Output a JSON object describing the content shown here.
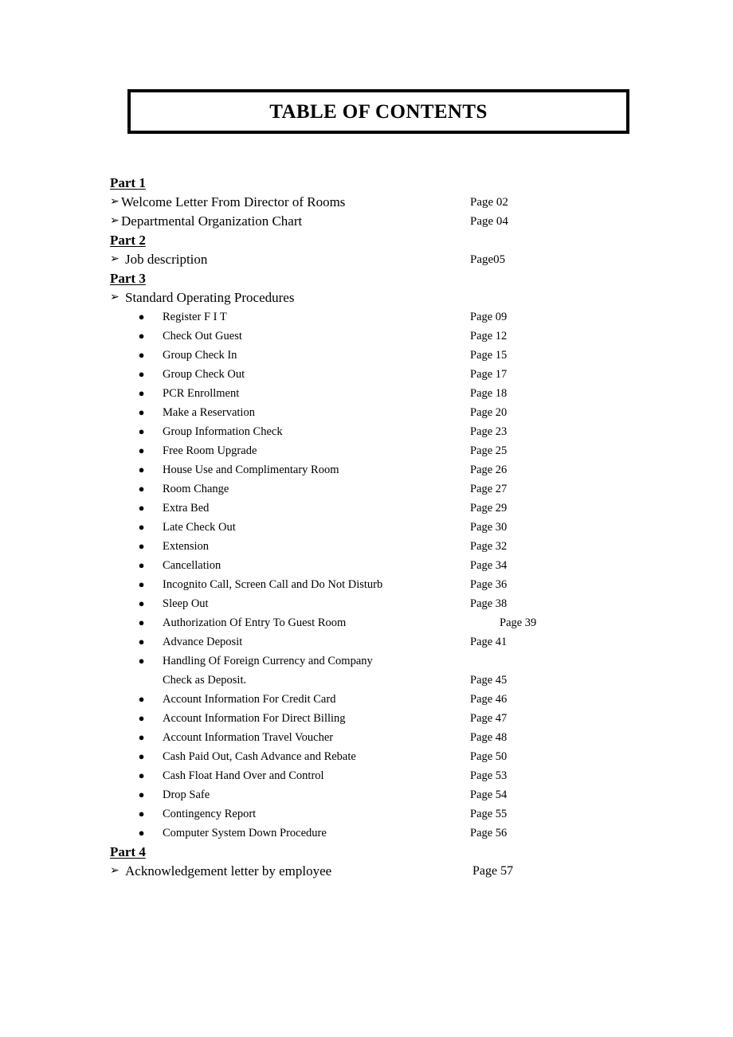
{
  "document": {
    "title": "TABLE OF CONTENTS"
  },
  "icons": {
    "arrow_bullet": "➢",
    "disc_bullet": "●"
  },
  "sections": [
    {
      "heading": "Part 1",
      "entries": [
        {
          "label": "Welcome Letter From Director of Rooms",
          "page": "Page 02"
        },
        {
          "label": "Departmental Organization Chart",
          "page": "Page 04"
        }
      ]
    },
    {
      "heading": "Part 2",
      "entries": [
        {
          "label": "Job description",
          "page": "Page05"
        }
      ]
    },
    {
      "heading": "Part 3",
      "entries": [
        {
          "label": "Standard Operating Procedures",
          "page": ""
        }
      ],
      "items": [
        {
          "label": "Register F I T",
          "page": "Page 09"
        },
        {
          "label": "Check Out Guest",
          "page": "Page 12"
        },
        {
          "label": "Group Check In",
          "page": "Page 15"
        },
        {
          "label": "Group Check Out",
          "page": "Page 17"
        },
        {
          "label": "PCR Enrollment",
          "page": "Page 18"
        },
        {
          "label": "Make a Reservation",
          "page": "Page 20"
        },
        {
          "label": "Group Information Check",
          "page": "Page 23"
        },
        {
          "label": "Free Room Upgrade",
          "page": "Page 25"
        },
        {
          "label": "House Use and Complimentary Room",
          "page": "Page 26"
        },
        {
          "label": "Room Change",
          "page": "Page 27"
        },
        {
          "label": "Extra Bed",
          "page": "Page 29"
        },
        {
          "label": "Late Check Out",
          "page": "Page 30"
        },
        {
          "label": "Extension",
          "page": "Page 32"
        },
        {
          "label": "Cancellation",
          "page": "Page 34"
        },
        {
          "label": "Incognito Call, Screen Call and Do Not Disturb",
          "page": "Page 36"
        },
        {
          "label": "Sleep Out",
          "page": "Page 38"
        },
        {
          "label": "Authorization Of Entry To Guest Room",
          "page": "Page 39"
        },
        {
          "label": "Advance Deposit",
          "page": "Page 41"
        },
        {
          "label": "Handling Of Foreign Currency and Company",
          "label_line2": "Check as Deposit.",
          "page": "Page 45"
        },
        {
          "label": "Account Information For Credit Card",
          "page": "Page 46"
        },
        {
          "label": "Account Information For Direct Billing",
          "page": "Page 47"
        },
        {
          "label": "Account Information Travel Voucher",
          "page": "Page 48"
        },
        {
          "label": "Cash Paid Out, Cash Advance and Rebate",
          "page": "Page 50"
        },
        {
          "label": "Cash Float Hand Over and Control",
          "page": "Page 53"
        },
        {
          "label": "Drop Safe",
          "page": "Page 54"
        },
        {
          "label": "Contingency Report",
          "page": "Page 55"
        },
        {
          "label": "Computer System Down Procedure",
          "page": "Page 56"
        }
      ]
    },
    {
      "heading": "Part 4",
      "entries": [
        {
          "label": "Acknowledgement letter by employee",
          "page": "Page 57"
        }
      ]
    }
  ]
}
